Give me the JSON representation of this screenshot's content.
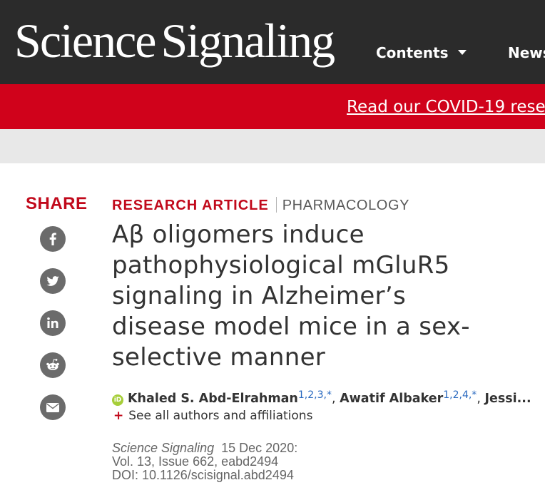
{
  "header": {
    "logo_word1": "Science",
    "logo_word2": "Signaling",
    "nav": [
      {
        "label": "Contents"
      },
      {
        "label": "News"
      }
    ]
  },
  "banner": {
    "link_text": "Read our COVID-19 rese"
  },
  "share": {
    "label": "SHARE",
    "buttons": [
      "facebook-icon",
      "twitter-icon",
      "linkedin-icon",
      "reddit-icon",
      "email-icon"
    ]
  },
  "article": {
    "type": "RESEARCH ARTICLE",
    "subject": "PHARMACOLOGY",
    "title": "Aβ oligomers induce pathophysiological mGluR5 signaling in Alzheimer’s disease model mice in a sex-selective manner",
    "authors": [
      {
        "name": "Khaled S. Abd-Elrahman",
        "affiliations": "1,2,3,*"
      },
      {
        "name": "Awatif Albaker",
        "affiliations": "1,2,4,*"
      },
      {
        "name": "Jessi..."
      }
    ],
    "see_all": "See all authors and affiliations",
    "journal": "Science Signaling",
    "date": "15 Dec 2020:",
    "volume": "Vol. 13, Issue 662, eabd2494",
    "doi": "DOI: 10.1126/scisignal.abd2494"
  },
  "colors": {
    "header_bg": "#2b2b2b",
    "banner_bg": "#d0021b",
    "accent_red": "#c1091b",
    "share_icon_bg": "#6b6b6b",
    "orcid_green": "#a6ce39"
  }
}
